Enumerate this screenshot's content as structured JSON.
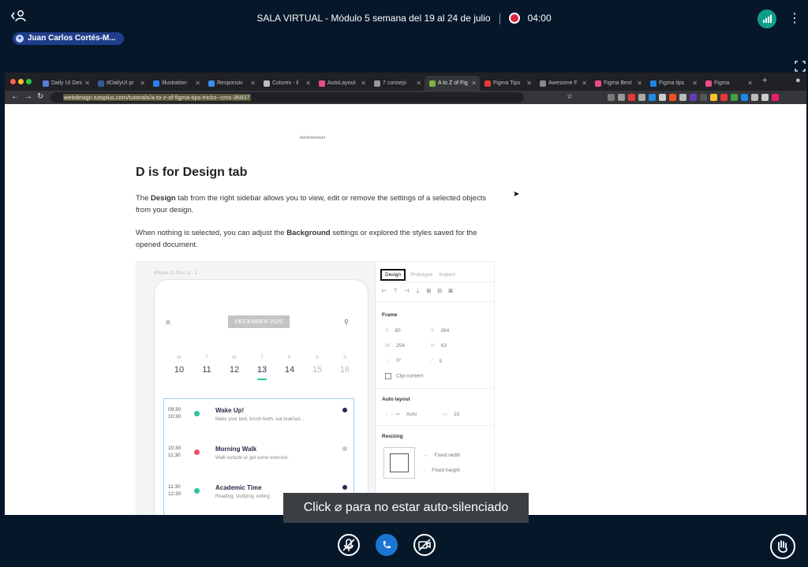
{
  "meeting": {
    "title": "SALA VIRTUAL - Módulo 5 semana del 19 al 24 de julio",
    "timer": "04:00",
    "user_name": "Juan Carlos Cortés-M...",
    "toast_before": "Click",
    "toast_after": "para no estar auto-silenciado"
  },
  "browser": {
    "tabs": [
      "Daily UI Des",
      "#DailyUI pr",
      "Illustration",
      "Responsiv",
      "Colores - li",
      "AutoLayout",
      "7 consejo",
      "A to Z of Fig",
      "Figma Tips",
      "Awesome F",
      "Figma Best",
      "Figma tips",
      "Figma"
    ],
    "active_tab_index": 7,
    "url": "webdesign.tutsplus.com/tutorials/a-to-z-of-figma-tips-tricks--cms-36837"
  },
  "article": {
    "advertisement": "Advertisement",
    "heading": "D is for Design tab",
    "p1_a": "The ",
    "p1_b": "Design",
    "p1_c": " tab from the right sidebar allows you to view, edit or remove the settings of a selected objects from your design.",
    "p2_a": "When nothing is selected, you can adjust the ",
    "p2_b": "Background",
    "p2_c": " settings or explored the styles saved for the opened document."
  },
  "figma": {
    "frame_label": "iPhone 11 Pro / X - 1",
    "month": "DECEMBER 2020",
    "days": [
      {
        "d": "M",
        "n": "10"
      },
      {
        "d": "T",
        "n": "11"
      },
      {
        "d": "W",
        "n": "12"
      },
      {
        "d": "T",
        "n": "13"
      },
      {
        "d": "F",
        "n": "14"
      },
      {
        "d": "S",
        "n": "15"
      },
      {
        "d": "S",
        "n": "16"
      }
    ],
    "events": [
      {
        "start": "09:30",
        "end": "10:30",
        "title": "Wake Up!",
        "desc": "Make your bed, brush teeth, eat brakfast..."
      },
      {
        "start": "10:30",
        "end": "11:30",
        "title": "Morning Walk",
        "desc": "Walk outside or get some exercise."
      },
      {
        "start": "11:30",
        "end": "12:30",
        "title": "Academic Time",
        "desc": "Reading, studying, writing."
      }
    ],
    "panel": {
      "tabs": [
        "Design",
        "Prototype",
        "Inspect"
      ],
      "frame": "Frame",
      "x_label": "X",
      "x": "80",
      "y_label": "Y",
      "y": "264",
      "w_label": "W",
      "w": "254",
      "h_label": "H",
      "h": "63",
      "rotation": "0°",
      "radius": "5",
      "clip": "Clip content",
      "auto_layout": "Auto layout",
      "auto": "Auto",
      "spacing": "10",
      "resizing": "Resizing",
      "fixed_width": "Fixed width",
      "fixed_height": "Fixed height"
    }
  },
  "colors": {
    "accent": "#1a76d2",
    "record": "#e0233c",
    "check": "#2ec4a0"
  }
}
